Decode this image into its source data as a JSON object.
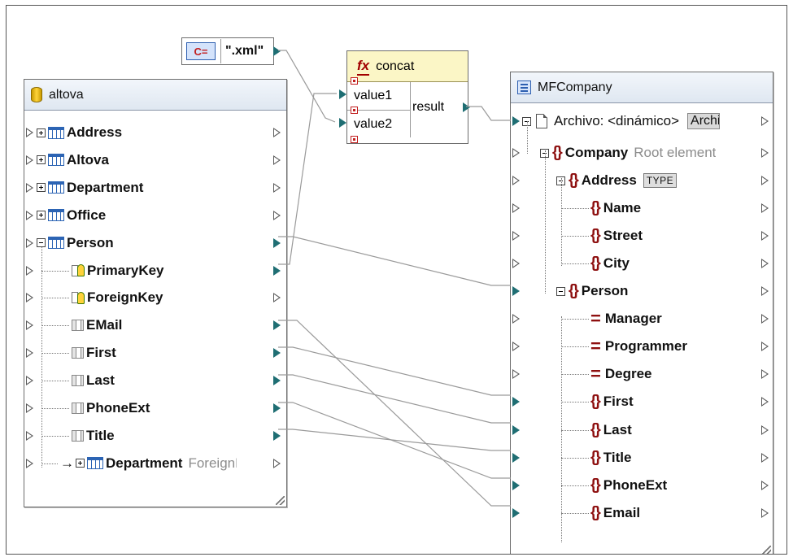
{
  "colors": {
    "wire": "#9a9a9a",
    "connected_port": "#1f6e73",
    "element_brace": "#8e1010"
  },
  "constant": {
    "icon_label": "C=",
    "value": "\".xml\""
  },
  "function": {
    "name": "concat",
    "inputs": [
      "value1",
      "value2"
    ],
    "output": "result"
  },
  "source": {
    "title": "altova",
    "rows": [
      {
        "label": "Address",
        "kind": "table",
        "state": "collapsed"
      },
      {
        "label": "Altova",
        "kind": "table",
        "state": "collapsed"
      },
      {
        "label": "Department",
        "kind": "table",
        "state": "collapsed"
      },
      {
        "label": "Office",
        "kind": "table",
        "state": "collapsed"
      },
      {
        "label": "Person",
        "kind": "table",
        "state": "expanded"
      },
      {
        "label": "PrimaryKey",
        "kind": "key"
      },
      {
        "label": "ForeignKey",
        "kind": "key"
      },
      {
        "label": "EMail",
        "kind": "column"
      },
      {
        "label": "First",
        "kind": "column"
      },
      {
        "label": "Last",
        "kind": "column"
      },
      {
        "label": "PhoneExt",
        "kind": "column"
      },
      {
        "label": "Title",
        "kind": "column"
      },
      {
        "label": "Department",
        "kind": "relation",
        "note": "ForeignKey"
      }
    ]
  },
  "target": {
    "title": "MFCompany",
    "file_row": {
      "label": "Archivo: <dinámico>",
      "button": "Archivo"
    },
    "rows": [
      {
        "label": "Company",
        "kind": "element",
        "note": "Root element"
      },
      {
        "label": "Address",
        "kind": "element",
        "badge": "TYPE"
      },
      {
        "label": "Name",
        "kind": "element"
      },
      {
        "label": "Street",
        "kind": "element"
      },
      {
        "label": "City",
        "kind": "element"
      },
      {
        "label": "Person",
        "kind": "element"
      },
      {
        "label": "Manager",
        "kind": "attribute"
      },
      {
        "label": "Programmer",
        "kind": "attribute"
      },
      {
        "label": "Degree",
        "kind": "attribute"
      },
      {
        "label": "First",
        "kind": "element"
      },
      {
        "label": "Last",
        "kind": "element"
      },
      {
        "label": "Title",
        "kind": "element"
      },
      {
        "label": "PhoneExt",
        "kind": "element"
      },
      {
        "label": "Email",
        "kind": "element"
      }
    ]
  }
}
